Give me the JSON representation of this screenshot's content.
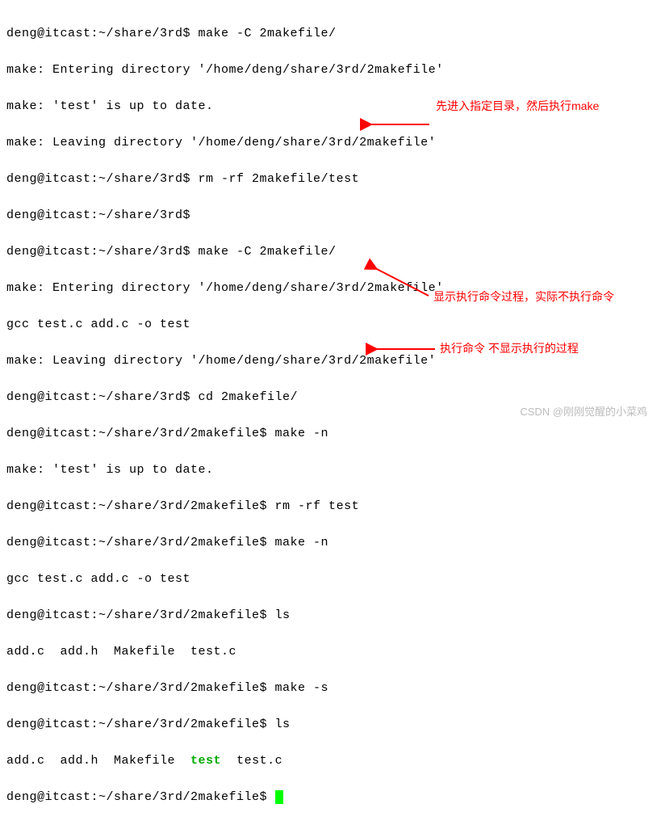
{
  "lines": [
    "deng@itcast:~/share/3rd$ make -C 2makefile/",
    "make: Entering directory '/home/deng/share/3rd/2makefile'",
    "make: 'test' is up to date.",
    "make: Leaving directory '/home/deng/share/3rd/2makefile'",
    "deng@itcast:~/share/3rd$ rm -rf 2makefile/test",
    "deng@itcast:~/share/3rd$",
    "deng@itcast:~/share/3rd$ make -C 2makefile/",
    "make: Entering directory '/home/deng/share/3rd/2makefile'",
    "gcc test.c add.c -o test",
    "make: Leaving directory '/home/deng/share/3rd/2makefile'",
    "deng@itcast:~/share/3rd$ cd 2makefile/",
    "deng@itcast:~/share/3rd/2makefile$ make -n",
    "make: 'test' is up to date.",
    "deng@itcast:~/share/3rd/2makefile$ rm -rf test",
    "deng@itcast:~/share/3rd/2makefile$ make -n",
    "gcc test.c add.c -o test",
    "deng@itcast:~/share/3rd/2makefile$ ls",
    "add.c  add.h  Makefile  test.c",
    "deng@itcast:~/share/3rd/2makefile$ make -s",
    "deng@itcast:~/share/3rd/2makefile$ ls"
  ],
  "ls_line": {
    "p1": "add.c  add.h  Makefile  ",
    "test": "test",
    "p2": "  test.c"
  },
  "final_prompt": "deng@itcast:~/share/3rd/2makefile$ ",
  "annotations": {
    "a1": "先进入指定目录，然后执行make",
    "a2": "显示执行命令过程，实际不执行命令",
    "a3": "执行命令 不显示执行的过程"
  },
  "watermark": "CSDN @刚刚觉醒的小菜鸡"
}
